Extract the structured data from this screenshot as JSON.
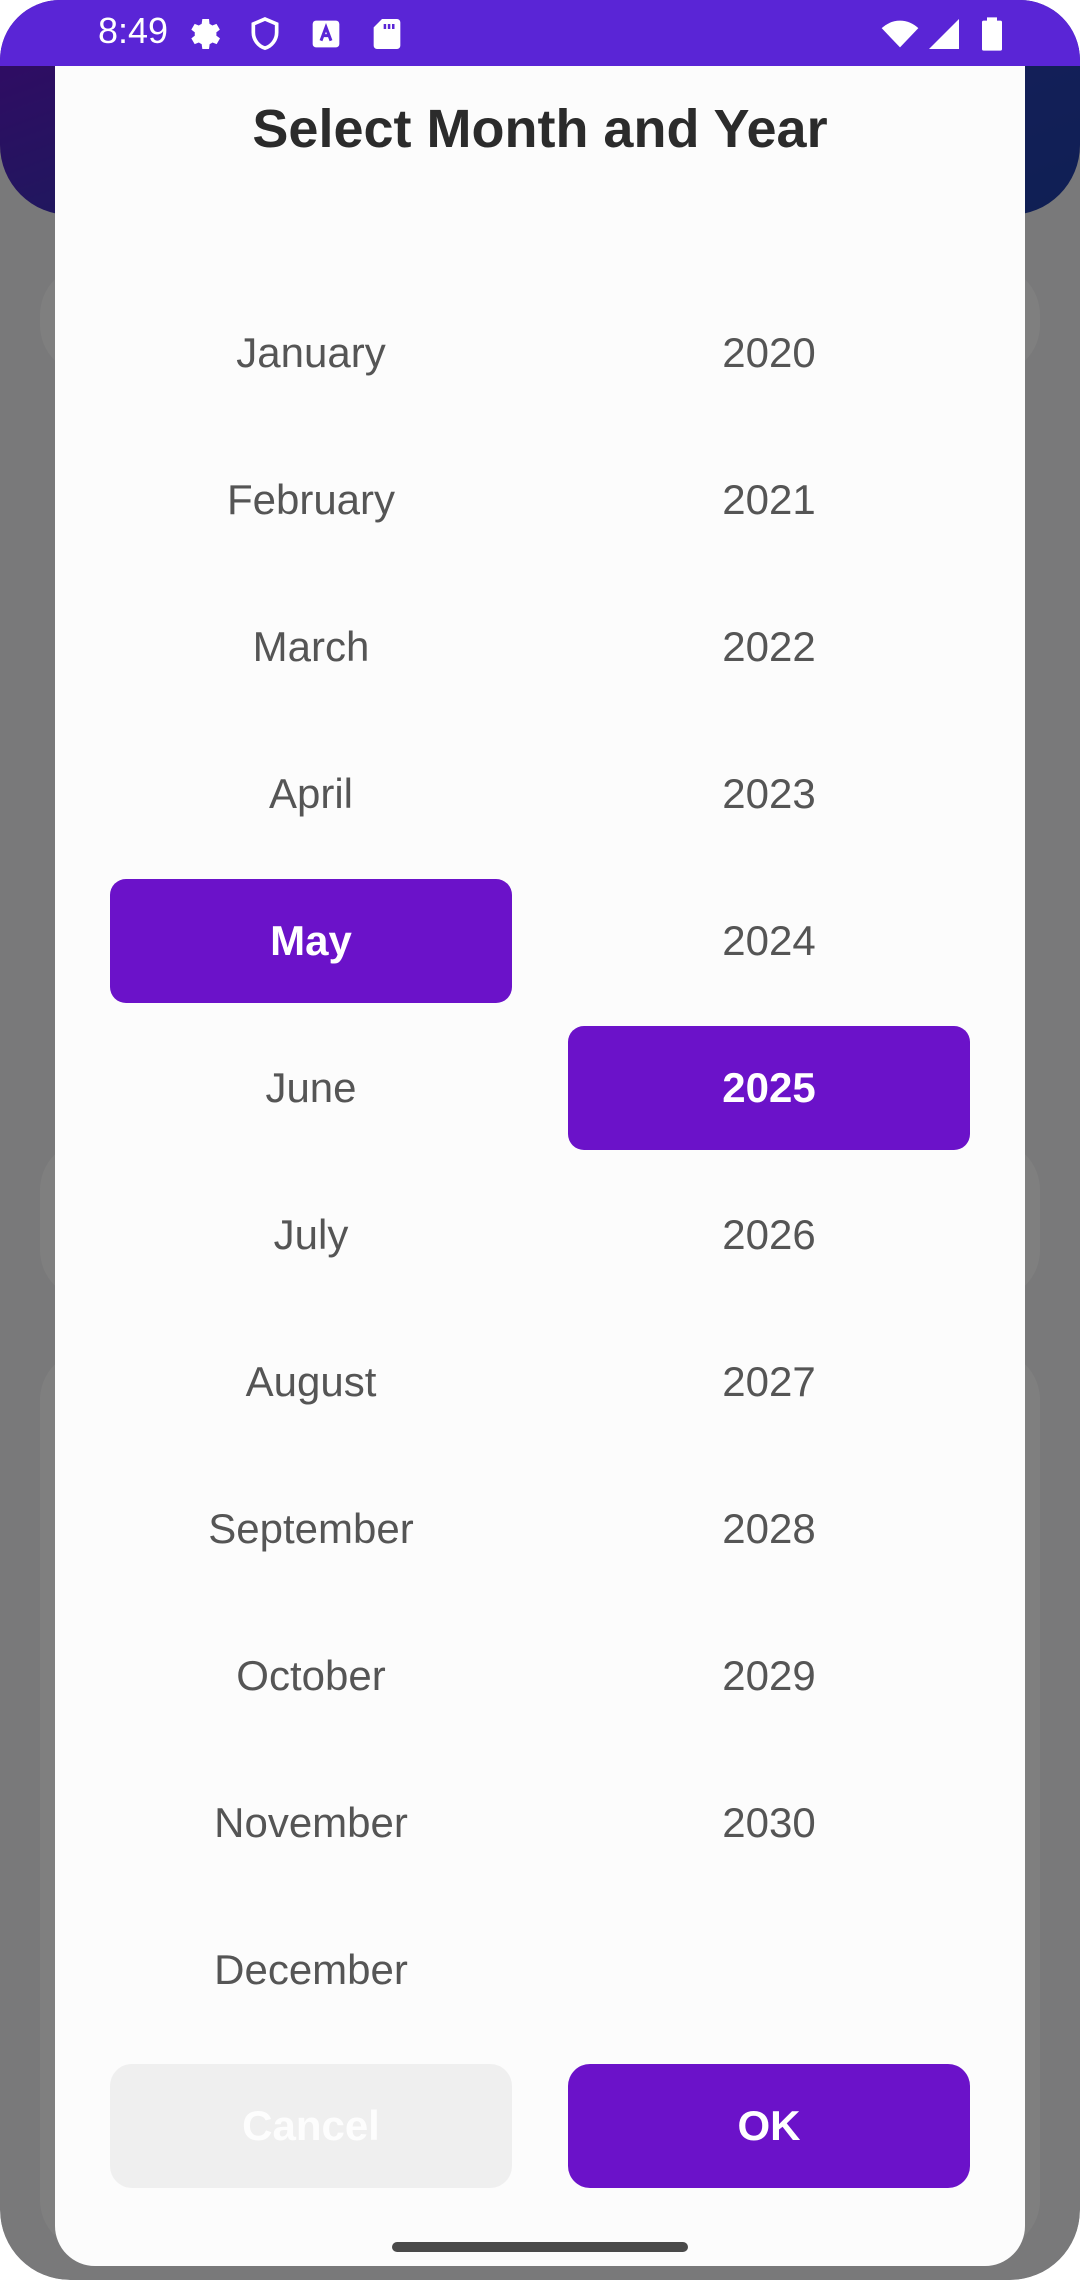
{
  "status_bar": {
    "time": "8:49",
    "left_icons": [
      "settings-icon",
      "shield-icon",
      "font-a-icon",
      "sd-card-icon"
    ],
    "right_icons": [
      "wifi-icon",
      "signal-icon",
      "battery-icon"
    ]
  },
  "dialog": {
    "title": "Select Month and Year",
    "months": [
      {
        "label": "January",
        "selected": false
      },
      {
        "label": "February",
        "selected": false
      },
      {
        "label": "March",
        "selected": false
      },
      {
        "label": "April",
        "selected": false
      },
      {
        "label": "May",
        "selected": true
      },
      {
        "label": "June",
        "selected": false
      },
      {
        "label": "July",
        "selected": false
      },
      {
        "label": "August",
        "selected": false
      },
      {
        "label": "September",
        "selected": false
      },
      {
        "label": "October",
        "selected": false
      },
      {
        "label": "November",
        "selected": false
      },
      {
        "label": "December",
        "selected": false
      }
    ],
    "years": [
      {
        "label": "2020",
        "selected": false
      },
      {
        "label": "2021",
        "selected": false
      },
      {
        "label": "2022",
        "selected": false
      },
      {
        "label": "2023",
        "selected": false
      },
      {
        "label": "2024",
        "selected": false
      },
      {
        "label": "2025",
        "selected": true
      },
      {
        "label": "2026",
        "selected": false
      },
      {
        "label": "2027",
        "selected": false
      },
      {
        "label": "2028",
        "selected": false
      },
      {
        "label": "2029",
        "selected": false
      },
      {
        "label": "2030",
        "selected": false
      }
    ],
    "cancel_label": "Cancel",
    "ok_label": "OK"
  },
  "colors": {
    "accent": "#6b12c9",
    "status_bar": "#5a25d6",
    "scrim": "rgba(0,0,0,0.5)"
  }
}
